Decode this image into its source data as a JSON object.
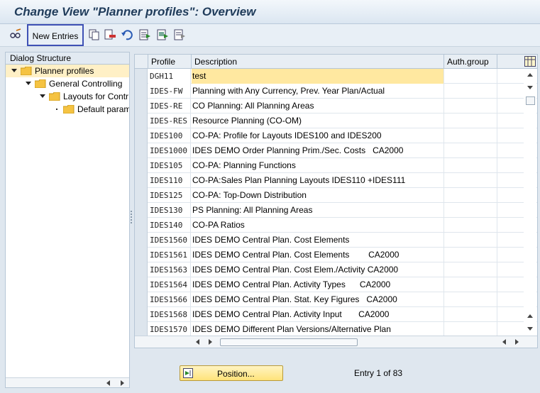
{
  "title": "Change View \"Planner profiles\": Overview",
  "toolbar": {
    "new_entries_label": "New Entries",
    "icons": [
      "glasses-pencil-icon",
      "copy-icon",
      "delete-icon",
      "undo-icon",
      "select-all-icon",
      "select-block-icon",
      "deselect-all-icon"
    ]
  },
  "dialog_structure": {
    "header": "Dialog Structure",
    "items": [
      {
        "label": "Planner profiles",
        "level": 0,
        "expanded": true,
        "selected": true
      },
      {
        "label": "General Controlling",
        "level": 1,
        "expanded": true
      },
      {
        "label": "Layouts for Contr",
        "level": 2,
        "expanded": true
      },
      {
        "label": "Default param",
        "level": 3,
        "expanded": false
      }
    ]
  },
  "table": {
    "columns": {
      "profile": "Profile",
      "description": "Description",
      "auth_group": "Auth.group"
    },
    "rows": [
      {
        "profile": "DGH11",
        "description": "test"
      },
      {
        "profile": "IDES-FW",
        "description": "Planning with Any Currency, Prev. Year Plan/Actual"
      },
      {
        "profile": "IDES-RE",
        "description": "CO Planning: All Planning Areas"
      },
      {
        "profile": "IDES-RES",
        "description": "Resource Planning (CO-OM)"
      },
      {
        "profile": "IDES100",
        "description": "CO-PA: Profile for Layouts IDES100 and IDES200"
      },
      {
        "profile": "IDES1000",
        "description": "IDES DEMO Order Planning Prim./Sec. Costs   CA2000"
      },
      {
        "profile": "IDES105",
        "description": "CO-PA: Planning Functions"
      },
      {
        "profile": "IDES110",
        "description": "CO-PA:Sales Plan Planning Layouts IDES110 +IDES111"
      },
      {
        "profile": "IDES125",
        "description": "CO-PA: Top-Down Distribution"
      },
      {
        "profile": "IDES130",
        "description": "PS Planning: All Planning Areas"
      },
      {
        "profile": "IDES140",
        "description": "CO-PA Ratios"
      },
      {
        "profile": "IDES1560",
        "description": "IDES DEMO Central Plan. Cost Elements"
      },
      {
        "profile": "IDES1561",
        "description": "IDES DEMO Central Plan. Cost Elements        CA2000"
      },
      {
        "profile": "IDES1563",
        "description": "IDES DEMO Central Plan. Cost Elem./Activity CA2000"
      },
      {
        "profile": "IDES1564",
        "description": "IDES DEMO Central Plan. Activity Types      CA2000"
      },
      {
        "profile": "IDES1566",
        "description": "IDES DEMO Central Plan. Stat. Key Figures   CA2000"
      },
      {
        "profile": "IDES1568",
        "description": "IDES DEMO Central Plan. Activity Input       CA2000"
      },
      {
        "profile": "IDES1570",
        "description": "IDES DEMO Different Plan Versions/Alternative Plan"
      }
    ]
  },
  "footer": {
    "position_button": "Position...",
    "entry_text": "Entry 1 of 83"
  },
  "colors": {
    "selected_row": "#fff0c6",
    "active_cell": "#ffe8a0",
    "highlight_border": "#3f51b5"
  }
}
